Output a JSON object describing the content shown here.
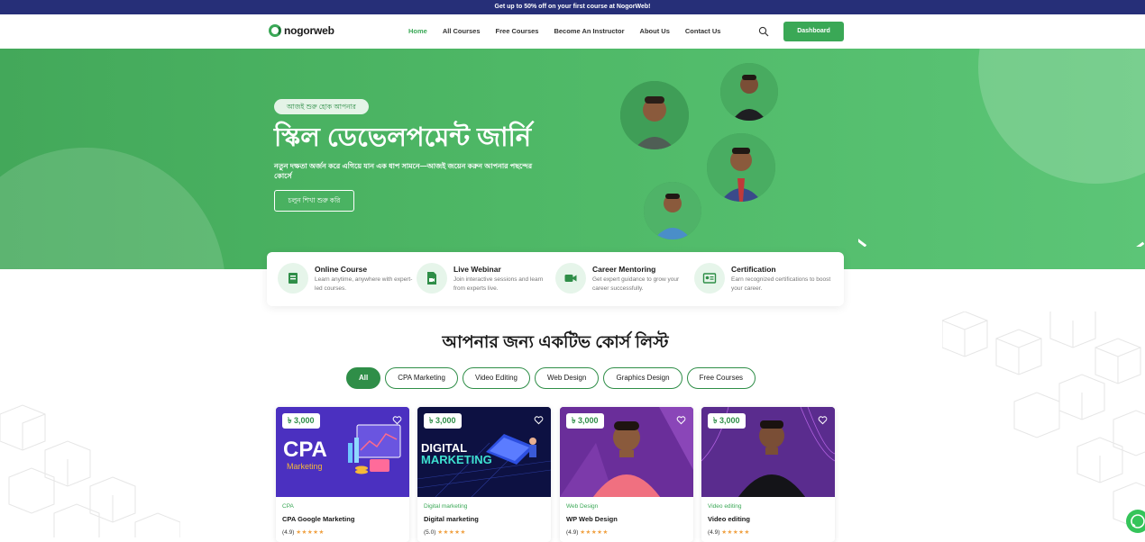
{
  "topbar": {
    "text": "Get up to 50% off on your first course at NogorWeb!"
  },
  "nav": {
    "logo_text": "nogorweb",
    "items": [
      {
        "label": "Home",
        "active": true
      },
      {
        "label": "All Courses"
      },
      {
        "label": "Free Courses"
      },
      {
        "label": "Become An Instructor"
      },
      {
        "label": "About Us"
      },
      {
        "label": "Contact Us"
      }
    ],
    "dashboard_label": "Dashboard"
  },
  "hero": {
    "badge": "আজই শুরু হোক আপনার",
    "title": "স্কিল ডেভেলপমেন্ট জার্নি",
    "subtitle": "নতুন দক্ষতা অর্জন করে এগিয়ে যান এক ধাপ সামনে—আজই জয়েন করুন আপনার পছন্দের কোর্সে",
    "cta": "চলুন শিখা শুরু করি"
  },
  "features": [
    {
      "title": "Online Course",
      "desc": "Learn anytime, anywhere with expert-led courses.",
      "icon": "book-icon"
    },
    {
      "title": "Live Webinar",
      "desc": "Join interactive sessions and learn from experts live.",
      "icon": "video-file-icon"
    },
    {
      "title": "Career Mentoring",
      "desc": "Get expert guidance to grow your career successfully.",
      "icon": "camera-icon"
    },
    {
      "title": "Certification",
      "desc": "Earn recognized certifications to boost your career.",
      "icon": "certificate-icon"
    }
  ],
  "section": {
    "title": "আপনার জন্য একটিভ কোর্স লিস্ট",
    "filters": [
      "All",
      "CPA Marketing",
      "Video Editing",
      "Web Design",
      "Graphics Design",
      "Free Courses"
    ],
    "active_filter": "All"
  },
  "courses": [
    {
      "price": "৳ 3,000",
      "category": "CPA",
      "title": "CPA Google Marketing",
      "rating": "(4.9)",
      "stars": "★★★★★",
      "img_title": "CPA",
      "img_sub": "Marketing"
    },
    {
      "price": "৳ 3,000",
      "category": "Digital marketing",
      "title": "Digital marketing",
      "rating": "(5.0)",
      "stars": "★★★★★",
      "img_title": "DIGITAL",
      "img_sub": "MARKETING"
    },
    {
      "price": "৳ 3,000",
      "category": "Web Design",
      "title": "WP Web Design",
      "rating": "(4.9)",
      "stars": "★★★★★"
    },
    {
      "price": "৳ 3,000",
      "category": "Video editing",
      "title": "Video editing",
      "rating": "(4.9)",
      "stars": "★★★★★"
    }
  ],
  "colors": {
    "brand": "#3aa856",
    "topbar": "#262f78",
    "accent_dark": "#2f8e48"
  }
}
